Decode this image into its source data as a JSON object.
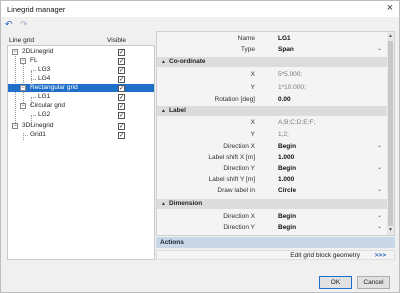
{
  "window": {
    "title": "Linegrid manager",
    "close_glyph": "×"
  },
  "toolbar": {
    "undo_glyph": "↶",
    "redo_glyph": "↷",
    "undo_icon": "undo-icon",
    "redo_icon": "redo-icon"
  },
  "tree": {
    "col_linegrid": "Line grid",
    "col_visible": "Visible",
    "items": [
      {
        "label": "2DLinegrid",
        "expander": "−",
        "checked": "✓"
      },
      {
        "label": "FL",
        "expander": "−",
        "checked": "✓"
      },
      {
        "label": "LG3",
        "expander": "",
        "checked": "✓"
      },
      {
        "label": "LG4",
        "expander": "",
        "checked": "✓"
      },
      {
        "label": "Rectangular grid",
        "expander": "−",
        "checked": "✓"
      },
      {
        "label": "LG1",
        "expander": "",
        "checked": "✓"
      },
      {
        "label": "Circular grid",
        "expander": "−",
        "checked": "✓"
      },
      {
        "label": "LG2",
        "expander": "",
        "checked": "✓"
      },
      {
        "label": "3DLinegrid",
        "expander": "−",
        "checked": "✓"
      },
      {
        "label": "Grid1",
        "expander": "",
        "checked": "✓"
      }
    ]
  },
  "props": {
    "name_label": "Name",
    "name_value": "LG1",
    "type_label": "Type",
    "type_value": "Span",
    "sec_coord": "Co-ordinate",
    "x_label": "X",
    "x_value": "5*5.000;",
    "y_label": "Y",
    "y_value": "1*10.000;",
    "rot_label": "Rotation [deg]",
    "rot_value": "0.00",
    "sec_label": "Label",
    "lx_label": "X",
    "lx_value": "A;B;C;D;E;F;",
    "ly_label": "Y",
    "ly_value": "1;2;",
    "dirx_label": "Direction X",
    "dirx_value": "Begin",
    "shiftx_label": "Label shift X [m]",
    "shiftx_value": "1.000",
    "diry_label": "Direction Y",
    "diry_value": "Begin",
    "shifty_label": "Label shift Y [m]",
    "shifty_value": "1.000",
    "draw_label": "Draw label in",
    "draw_value": "Circle",
    "sec_dim": "Dimension",
    "ddirx_label": "Direction X",
    "ddirx_value": "Begin",
    "ddiry_label": "Direction Y",
    "ddiry_value": "Begin",
    "dropdown_glyph": "⌄",
    "collapse_glyph": "▲",
    "scroll_up": "▲",
    "scroll_down": "▼"
  },
  "actions": {
    "header": "Actions",
    "edit_label": "Edit grid block geometry",
    "edit_dots": ">>>"
  },
  "buttons": {
    "ok": "OK",
    "cancel": "Cancel"
  }
}
